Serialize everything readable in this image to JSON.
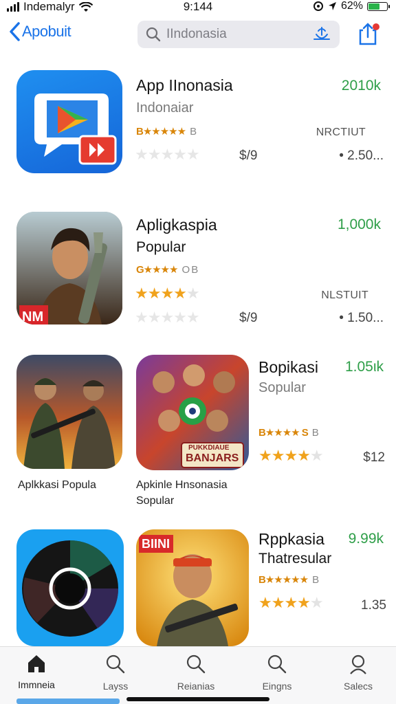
{
  "status_bar": {
    "carrier": "Indemalyr",
    "time": "9:144",
    "battery": "62%",
    "battery_level": 0.62
  },
  "nav": {
    "back_label": "Apobuit",
    "search_text": "IIndonasia",
    "icons": [
      "chevron-left-icon",
      "search-icon",
      "voice-search-icon",
      "share-icon"
    ]
  },
  "apps": [
    {
      "title": "App IInonasia",
      "subtitle": "Indonaiar",
      "count": "2010k",
      "rating_text": "B★★★★★",
      "rating_suffix": "B",
      "meta": "NRCTIUT",
      "price": "$/9",
      "price_right": "• 2.50...",
      "icon_label": ""
    },
    {
      "title": "Apligkaspia",
      "subtitle": "Popular",
      "count": "1,000k",
      "rating_text": "G★★★★",
      "rating_suffix": "O B",
      "meta": "NLSTUIT",
      "price": "$/9",
      "price_right": "• 1.50...",
      "icon_label": "NM"
    }
  ],
  "grid_row_1": {
    "left_caption": "Aplkkasi Popula",
    "middle_caption_1": "Apkinle Hnsonasia",
    "middle_caption_2": "Sopular",
    "middle_icon_label_1": "PUKKDIAUE",
    "middle_icon_label_2": "BANJARS",
    "title": "Bopikasi",
    "subtitle": "Sopular",
    "count": "1.05ιk",
    "rating_text": "B★★★★ S",
    "rating_suffix": "B",
    "price": "$12"
  },
  "grid_row_2": {
    "middle_icon_label": "BIINI",
    "title": "Rppkasia",
    "subtitle": "Thatresular",
    "count": "9.99k",
    "rating_text": "B★★★★★",
    "rating_suffix": "B",
    "price": "1.35"
  },
  "tabs": [
    {
      "label": "Immneia",
      "icon": "home-icon"
    },
    {
      "label": "Layss",
      "icon": "search-icon"
    },
    {
      "label": "Reianias",
      "icon": "search-icon"
    },
    {
      "label": "Eingns",
      "icon": "search-icon"
    },
    {
      "label": "Salecs",
      "icon": "profile-icon"
    }
  ],
  "colors": {
    "accent": "#1a73e8",
    "count_green": "#2e9e48",
    "star_orange": "#f0a21c"
  }
}
